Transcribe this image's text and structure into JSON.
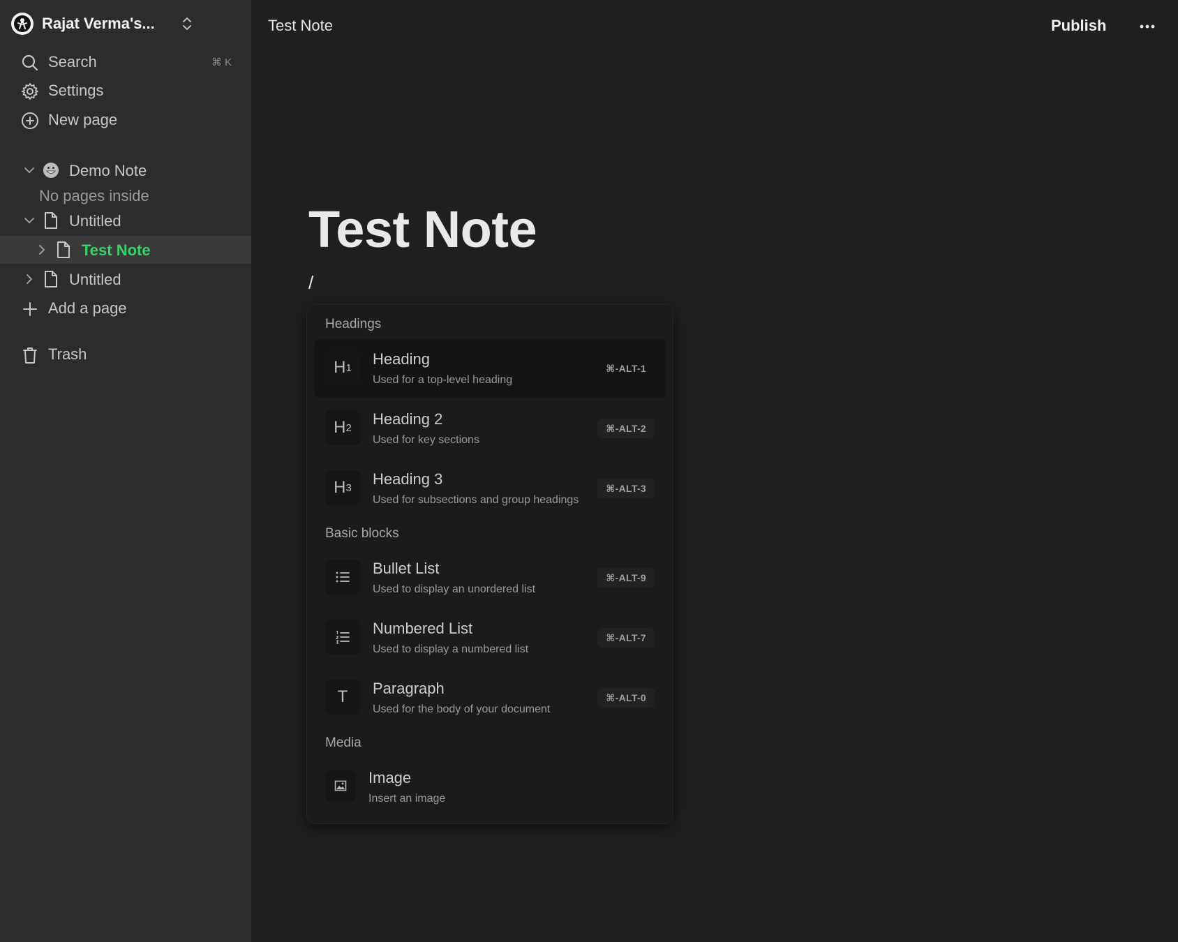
{
  "sidebar": {
    "workspace_name": "Rajat Verma's...",
    "search_label": "Search",
    "search_shortcut": "⌘ K",
    "settings_label": "Settings",
    "new_page_label": "New page",
    "tree": [
      {
        "label": "Demo Note",
        "icon": "grinning-emoji-icon",
        "expanded": true,
        "empty_hint": "No pages inside"
      },
      {
        "label": "Untitled",
        "icon": "document-icon",
        "expanded": true
      },
      {
        "label": "Test Note",
        "icon": "document-icon",
        "expanded": false,
        "active": true
      },
      {
        "label": "Untitled",
        "icon": "document-icon",
        "expanded": false
      }
    ],
    "add_page_label": "Add a page",
    "trash_label": "Trash"
  },
  "topbar": {
    "title": "Test Note",
    "publish_label": "Publish"
  },
  "document": {
    "title": "Test Note",
    "current_input": "/"
  },
  "slash_menu": {
    "sections": [
      {
        "title": "Headings",
        "items": [
          {
            "badge": "H1",
            "title": "Heading",
            "desc": "Used for a top-level heading",
            "shortcut": "⌘-ALT-1",
            "highlighted": true
          },
          {
            "badge": "H2",
            "title": "Heading 2",
            "desc": "Used for key sections",
            "shortcut": "⌘-ALT-2"
          },
          {
            "badge": "H3",
            "title": "Heading 3",
            "desc": "Used for subsections and group headings",
            "shortcut": "⌘-ALT-3"
          }
        ]
      },
      {
        "title": "Basic blocks",
        "items": [
          {
            "badge": "bullet-list-icon",
            "title": "Bullet List",
            "desc": "Used to display an unordered list",
            "shortcut": "⌘-ALT-9"
          },
          {
            "badge": "numbered-list-icon",
            "title": "Numbered List",
            "desc": "Used to display a numbered list",
            "shortcut": "⌘-ALT-7"
          },
          {
            "badge": "T",
            "title": "Paragraph",
            "desc": "Used for the body of your document",
            "shortcut": "⌘-ALT-0"
          }
        ]
      },
      {
        "title": "Media",
        "items": [
          {
            "badge": "image-icon",
            "title": "Image",
            "desc": "Insert an image"
          }
        ]
      }
    ]
  },
  "colors": {
    "sidebar_bg": "#2c2c2e",
    "main_bg": "#1f1f1f",
    "active_page": "#3ccf6a",
    "menu_bg": "#1b1b1b"
  }
}
